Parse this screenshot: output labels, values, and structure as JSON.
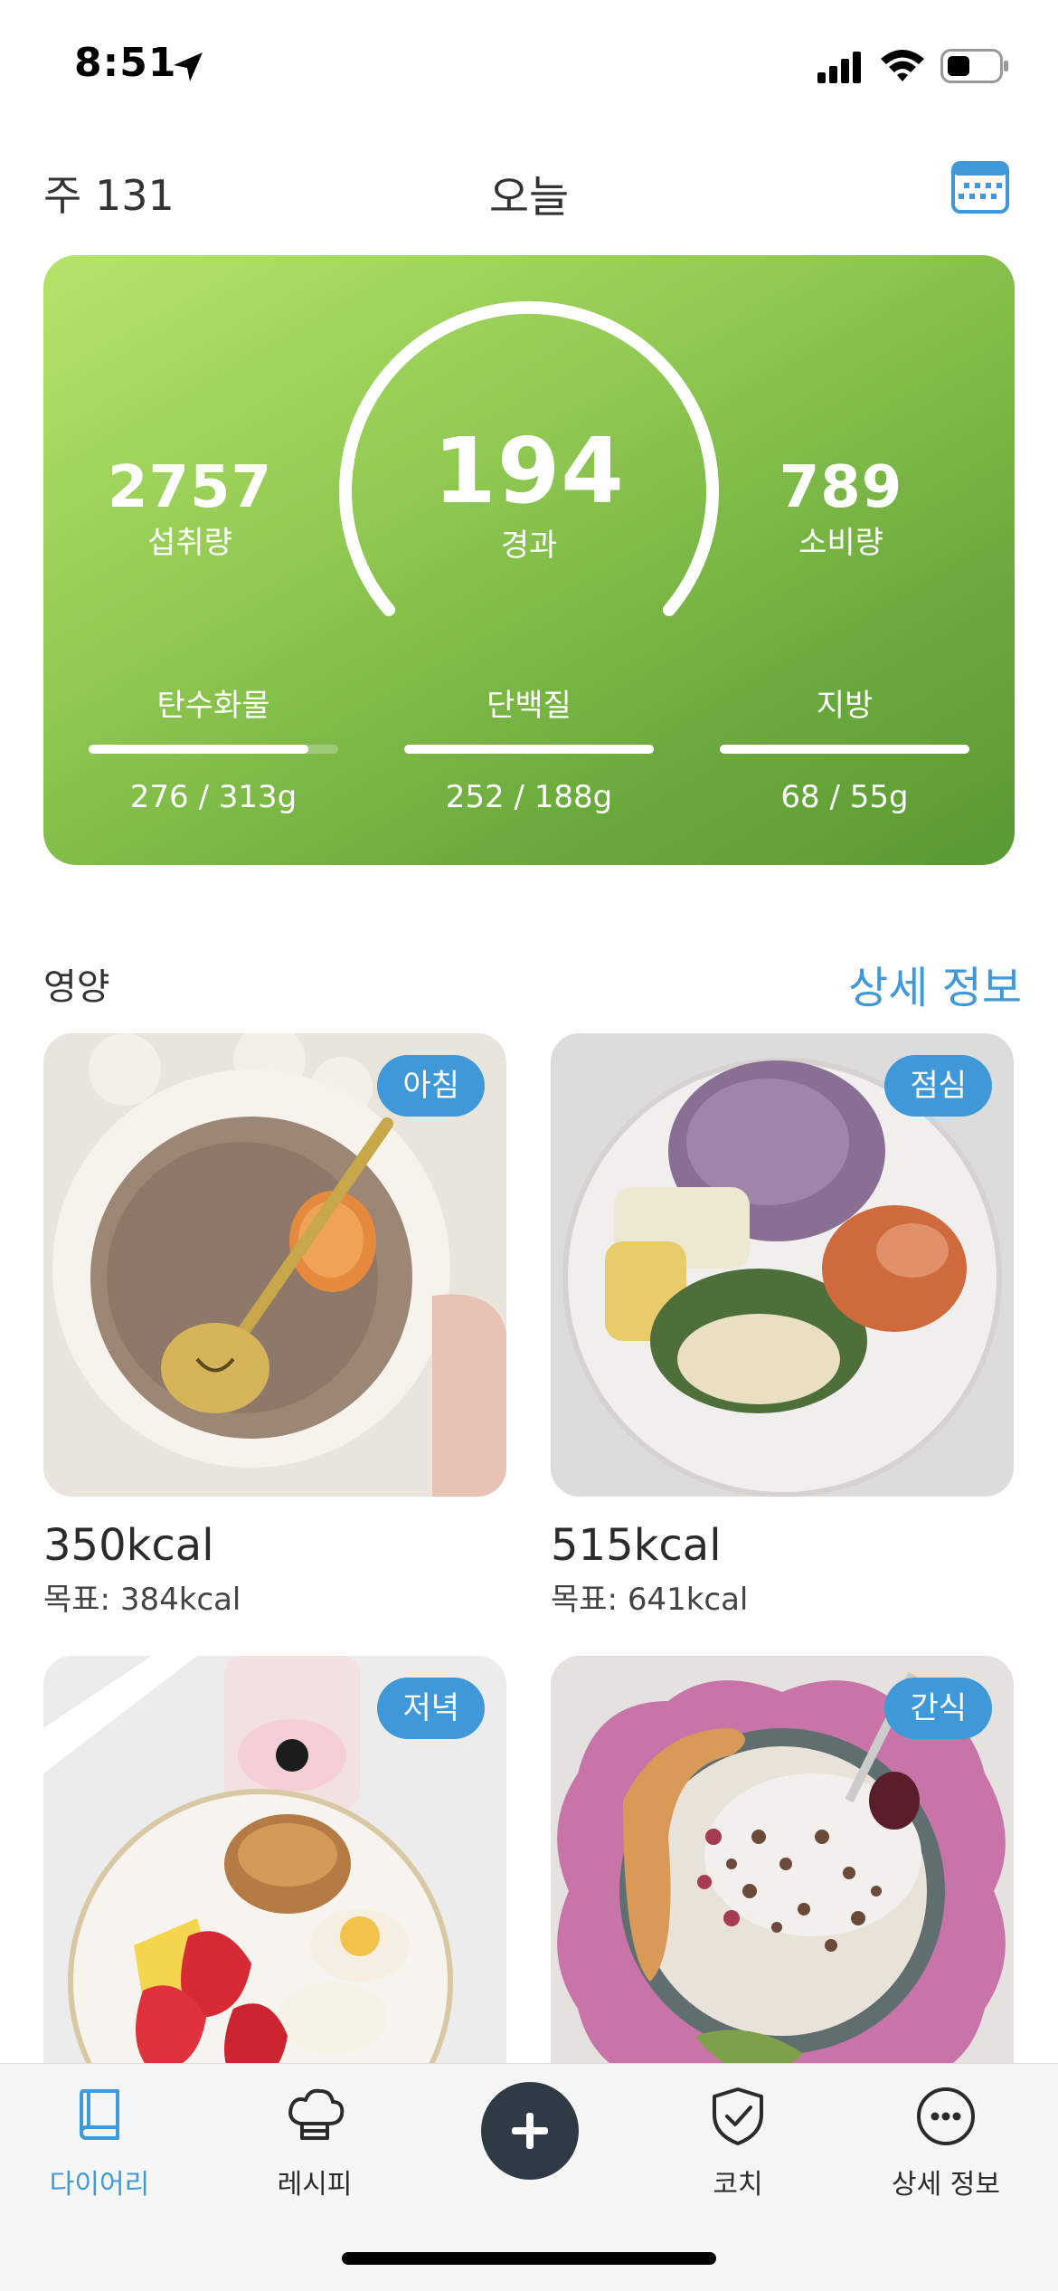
{
  "status_bar": {
    "time": "8:51"
  },
  "header": {
    "week": "주 131",
    "title": "오늘"
  },
  "summary": {
    "intake": {
      "value": "2757",
      "label": "섭취량"
    },
    "result": {
      "value": "194",
      "label": "경과"
    },
    "burned": {
      "value": "789",
      "label": "소비량"
    },
    "macros": [
      {
        "name": "탄수화물",
        "amount": "276 / 313g",
        "progress": 0.88
      },
      {
        "name": "단백질",
        "amount": "252 / 188g",
        "progress": 1.0
      },
      {
        "name": "지방",
        "amount": "68 / 55g",
        "progress": 1.0
      }
    ]
  },
  "nutrition": {
    "title": "영양",
    "details_link": "상세 정보",
    "meals": [
      {
        "badge": "아침",
        "kcal": "350kcal",
        "goal": "목표: 384kcal"
      },
      {
        "badge": "점심",
        "kcal": "515kcal",
        "goal": "목표: 641kcal"
      },
      {
        "badge": "저녁"
      },
      {
        "badge": "간식"
      }
    ]
  },
  "tab_bar": {
    "tabs": [
      {
        "label": "다이어리",
        "icon": "book-icon"
      },
      {
        "label": "레시피",
        "icon": "chef-hat-icon"
      },
      {
        "label": "",
        "icon": "plus-icon"
      },
      {
        "label": "코치",
        "icon": "shield-check-icon"
      },
      {
        "label": "상세 정보",
        "icon": "more-icon"
      }
    ]
  },
  "colors": {
    "accent": "#3f98d8",
    "card_start": "#b6e36a",
    "card_end": "#5a9a33",
    "add_button": "#2e3a44"
  }
}
